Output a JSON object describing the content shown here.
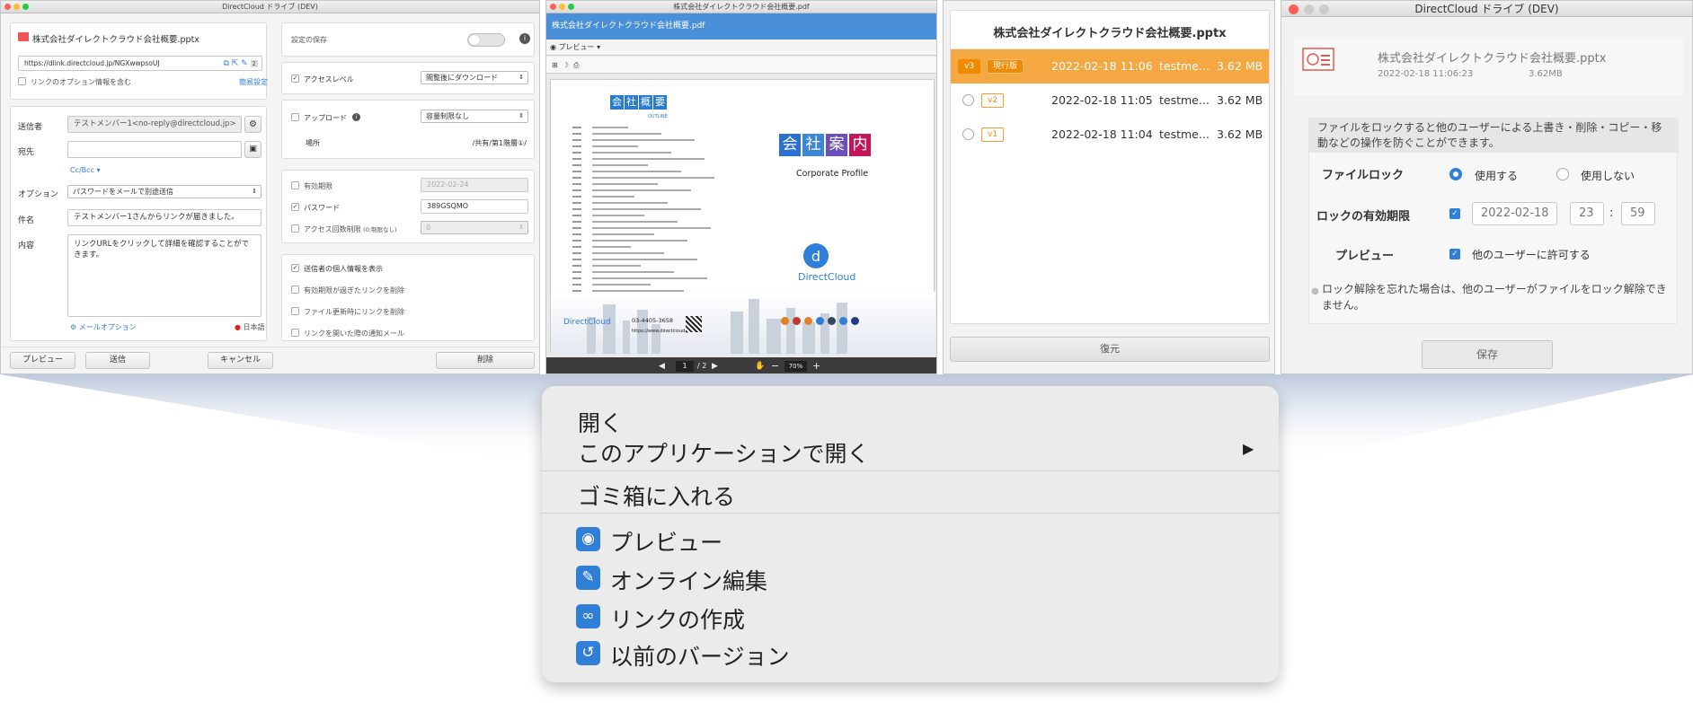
{
  "win1": {
    "title": "DirectCloud ドライブ (DEV)",
    "file_name": "株式会社ダイレクトクラウド会社概要.pptx",
    "link_url": "https://dlink.directcloud.jp/NGXwwpsoUJ",
    "link_count": "2",
    "link_option_check": "リンクのオプション情報を含む",
    "short_setting": "簡易設定",
    "sender_label": "送信者",
    "sender_value": "テストメンバー1<no-reply@directcloud.jp>",
    "to_label": "宛先",
    "ccbcc": "Cc/Bcc ▾",
    "option_label": "オプション",
    "option_value": "パスワードをメールで別途送信",
    "subject_label": "件名",
    "subject_value": "テストメンバー1さんからリンクが届きました。",
    "body_label": "内容",
    "body_value": "リンクURLをクリックして詳細を確認することができます。",
    "mail_option": "メールオプション",
    "language": "日本語",
    "save_setting": "設定の保存",
    "access_level_label": "アクセスレベル",
    "access_level_value": "閲覧後にダウンロード",
    "upload_label": "アップロード",
    "upload_value": "容量制限なし",
    "place_label": "場所",
    "place_value": "/共有/第1階層①/",
    "expiry_label": "有効期限",
    "expiry_value": "2022-02-24",
    "password_label": "パスワード",
    "password_value": "389GSQMO",
    "access_count_label": "アクセス回数制限",
    "access_count_note": "(0:制限なし)",
    "access_count_value": "0",
    "show_sender": "送信者の個人情報を表示",
    "delete_expired": "有効期限が過ぎたリンクを削除",
    "delete_on_update": "ファイル更新時にリンクを削除",
    "notify_open": "リンクを開いた際の通知メール",
    "btn_preview": "プレビュー",
    "btn_send": "送信",
    "btn_cancel": "キャンセル",
    "btn_delete": "削除"
  },
  "win2": {
    "title": "株式会社ダイレクトクラウド会社概要.pdf",
    "header": "株式会社ダイレクトクラウド会社概要.pdf",
    "preview_label": "プレビュー",
    "outline_title": "会社概要",
    "outline_sub": "OUTLINE",
    "company_kanji": [
      "会",
      "社",
      "案",
      "内"
    ],
    "corporate_profile": "Corporate Profile",
    "brand": "DirectCloud",
    "page_current": "1",
    "page_total": "/ 2",
    "zoom": "70%",
    "phone": "03-4405-3658",
    "website": "https://www.directcloud.jp"
  },
  "win3": {
    "title": "株式会社ダイレクトクラウド会社概要.pptx",
    "rows": [
      {
        "ver": "v3",
        "badge": "現行版",
        "date": "2022-02-18 11:06",
        "user": "testme...",
        "size": "3.62 MB"
      },
      {
        "ver": "v2",
        "badge": "",
        "date": "2022-02-18 11:05",
        "user": "testme...",
        "size": "3.62 MB"
      },
      {
        "ver": "v1",
        "badge": "",
        "date": "2022-02-18 11:04",
        "user": "testme...",
        "size": "3.62 MB"
      }
    ],
    "restore": "復元"
  },
  "win4": {
    "title": "DirectCloud ドライブ (DEV)",
    "file_name": "株式会社ダイレクトクラウド会社概要.pptx",
    "file_date": "2022-02-18 11:06:23",
    "file_size": "3.62MB",
    "description": "ファイルをロックすると他のユーザーによる上書き・削除・コピー・移動などの操作を防ぐことができます。",
    "lock_label": "ファイルロック",
    "use": "使用する",
    "not_use": "使用しない",
    "expiry_label": "ロックの有効期限",
    "expiry_date": "2022-02-18",
    "hour": "23",
    "colon": ":",
    "minute": "59",
    "preview_label": "プレビュー",
    "preview_allow": "他のユーザーに許可する",
    "note": "ロック解除を忘れた場合は、他のユーザーがファイルをロック解除できません。",
    "save": "保存"
  },
  "menu": {
    "open": "開く",
    "open_with": "このアプリケーションで開く",
    "trash": "ゴミ箱に入れる",
    "preview": "プレビュー",
    "online_edit": "オンライン編集",
    "create_link": "リンクの作成",
    "prev_version": "以前のバージョン",
    "arrow": "▶"
  },
  "colors": {
    "accent": "#2f7ed8",
    "highlight": "#f5a742",
    "pdf_header": "#4a90d9"
  }
}
